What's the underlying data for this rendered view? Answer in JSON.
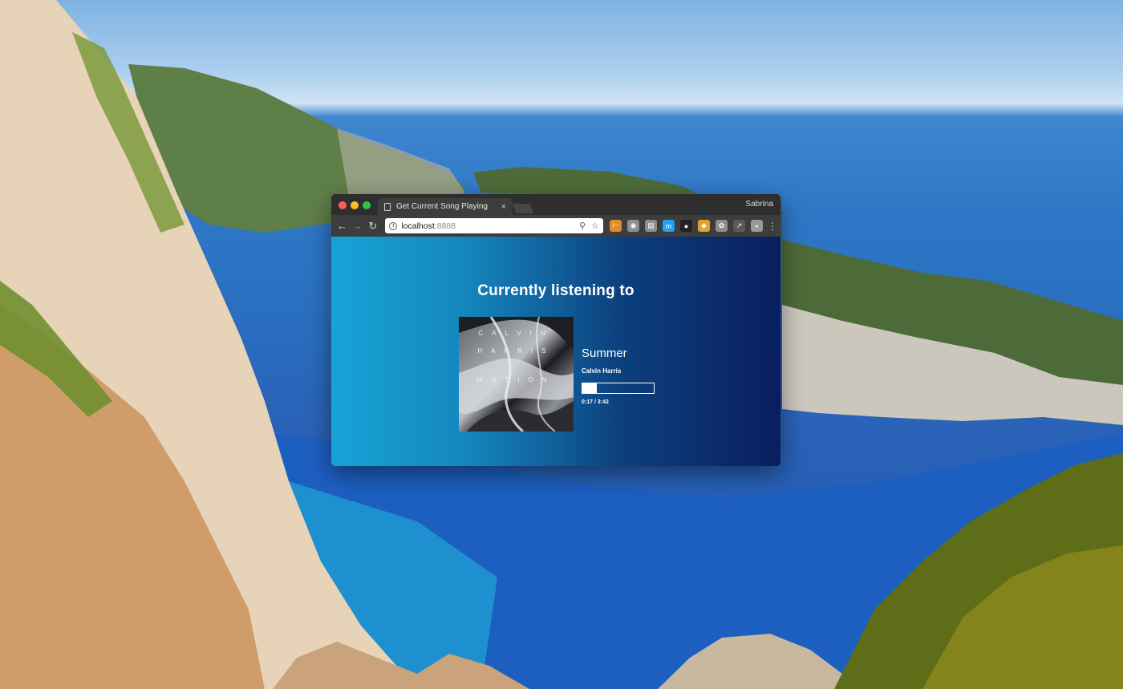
{
  "browser": {
    "tab": {
      "title": "Get Current Song Playing",
      "close_glyph": "×"
    },
    "profile_name": "Sabrina",
    "address_bar": {
      "host": "localhost",
      "port": ":8888"
    },
    "icons": [
      "back-icon",
      "forward-icon",
      "reload-icon",
      "info-icon",
      "zoom-icon",
      "bookmark-star-icon",
      "menu-icon"
    ]
  },
  "extensions": [
    {
      "name": "ext-1-icon",
      "glyph": "⊢",
      "color": "#e08b2e"
    },
    {
      "name": "ext-2-icon",
      "glyph": "◉",
      "color": "#8e8e8e"
    },
    {
      "name": "ext-3-icon",
      "glyph": "▤",
      "color": "#8e8e8e"
    },
    {
      "name": "ext-4-icon",
      "glyph": "m",
      "color": "#1da1f2"
    },
    {
      "name": "ext-5-icon",
      "glyph": "●",
      "color": "#222222"
    },
    {
      "name": "ext-6-icon",
      "glyph": "◆",
      "color": "#e0a32e"
    },
    {
      "name": "ext-7-icon",
      "glyph": "✿",
      "color": "#8e8e8e"
    },
    {
      "name": "ext-8-icon",
      "glyph": "↗",
      "color": "#5a5a5a"
    },
    {
      "name": "ext-9-icon",
      "glyph": "▪",
      "color": "#9a9a9a"
    }
  ],
  "page": {
    "heading": "Currently listening to",
    "album_art": {
      "lines": [
        "CALVIN",
        "HARRIS",
        "MOTION"
      ],
      "accent": "#b9bcc2"
    },
    "song": "Summer",
    "artist": "Calvin Harris",
    "progress_fraction": 0.2,
    "time": "0:17 / 3:42"
  },
  "colors": {
    "page_gradient": [
      "#16a3d6",
      "#1586bd",
      "#0c3f7d",
      "#0a1e5e"
    ],
    "titlebar": "#2e2e2e",
    "toolbar": "#3d3d3d"
  }
}
